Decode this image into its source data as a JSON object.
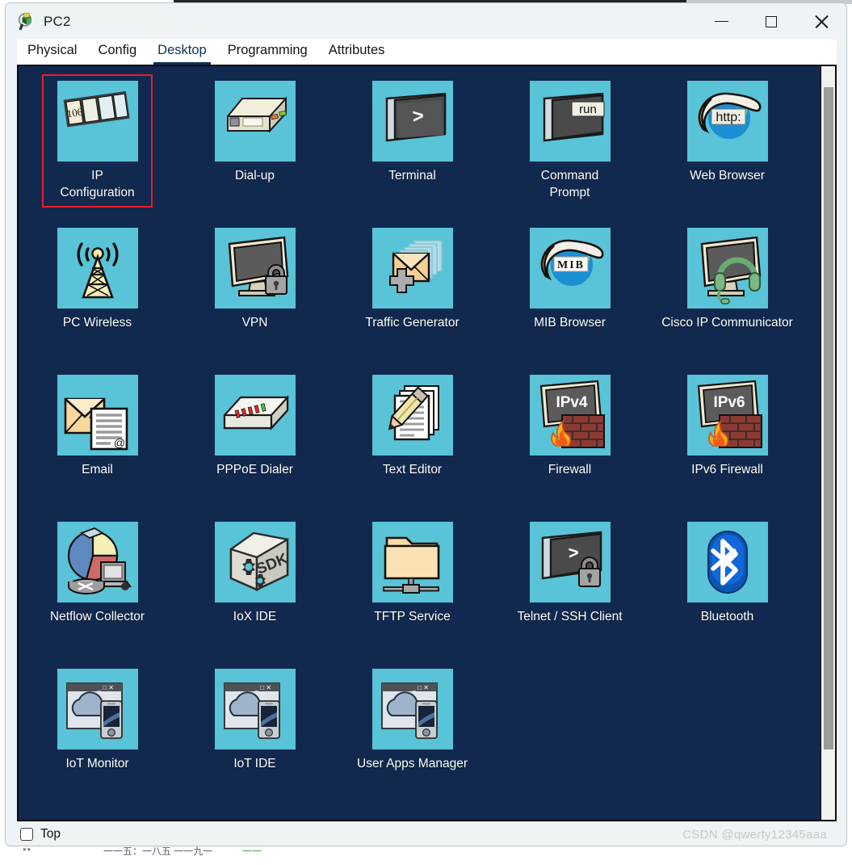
{
  "window": {
    "title": "PC2",
    "app_icon": "packet-tracer-pc-icon",
    "controls": {
      "minimize": "—",
      "maximize": "□",
      "close": "✕"
    }
  },
  "tabs": [
    {
      "label": "Physical",
      "active": false
    },
    {
      "label": "Config",
      "active": false
    },
    {
      "label": "Desktop",
      "active": true
    },
    {
      "label": "Programming",
      "active": false
    },
    {
      "label": "Attributes",
      "active": false
    }
  ],
  "desktop": {
    "background_color": "#11294e",
    "tile_color": "#59c3d7",
    "selection_color": "#ee1c24",
    "rows": [
      [
        {
          "label": "IP\nConfiguration",
          "icon": "ip-configuration-icon",
          "badge": "106",
          "selected": true
        },
        {
          "label": "Dial-up",
          "icon": "dial-up-modem-icon",
          "selected": false
        },
        {
          "label": "Terminal",
          "icon": "terminal-icon",
          "badge": ">",
          "selected": false
        },
        {
          "label": "Command\nPrompt",
          "icon": "command-prompt-icon",
          "badge": "run",
          "selected": false
        },
        {
          "label": "Web Browser",
          "icon": "web-browser-globe-icon",
          "badge": "http:",
          "selected": false
        }
      ],
      [
        {
          "label": "PC Wireless",
          "icon": "wireless-antenna-icon",
          "selected": false
        },
        {
          "label": "VPN",
          "icon": "vpn-monitor-lock-icon",
          "selected": false
        },
        {
          "label": "Traffic Generator",
          "icon": "traffic-generator-envelopes-icon",
          "selected": false
        },
        {
          "label": "MIB Browser",
          "icon": "mib-browser-globe-icon",
          "badge": "M I B",
          "selected": false
        },
        {
          "label": "Cisco IP Communicator",
          "icon": "ip-communicator-headset-icon",
          "selected": false
        }
      ],
      [
        {
          "label": "Email",
          "icon": "email-envelope-icon",
          "badge": "@",
          "selected": false
        },
        {
          "label": "PPPoE Dialer",
          "icon": "pppoe-dialer-modem-icon",
          "selected": false
        },
        {
          "label": "Text Editor",
          "icon": "text-editor-pencil-icon",
          "selected": false
        },
        {
          "label": "Firewall",
          "icon": "firewall-ipv4-icon",
          "badge": "IPv4",
          "selected": false
        },
        {
          "label": "IPv6 Firewall",
          "icon": "firewall-ipv6-icon",
          "badge": "IPv6",
          "selected": false
        }
      ],
      [
        {
          "label": "Netflow Collector",
          "icon": "netflow-collector-piechart-icon",
          "selected": false
        },
        {
          "label": "IoX IDE",
          "icon": "iox-ide-sdk-box-icon",
          "badge": "SDK",
          "selected": false
        },
        {
          "label": "TFTP Service",
          "icon": "tftp-folder-network-icon",
          "selected": false
        },
        {
          "label": "Telnet / SSH Client",
          "icon": "telnet-ssh-lock-icon",
          "badge": ">",
          "selected": false
        },
        {
          "label": "Bluetooth",
          "icon": "bluetooth-icon",
          "selected": false
        }
      ],
      [
        {
          "label": "IoT Monitor",
          "icon": "iot-monitor-cloud-phone-icon",
          "selected": false
        },
        {
          "label": "IoT IDE",
          "icon": "iot-ide-cloud-phone-icon",
          "selected": false
        },
        {
          "label": "User Apps Manager",
          "icon": "user-apps-manager-cloud-phone-icon",
          "selected": false
        }
      ]
    ]
  },
  "bottom": {
    "top_checkbox_label": "Top",
    "top_checkbox_checked": false,
    "watermark": "CSDN @qwerty12345aaa"
  },
  "behind": {
    "ghost_left": "••",
    "ghost_mid": "一一五：一八五   一一九一",
    "ghost_right": "一一"
  }
}
